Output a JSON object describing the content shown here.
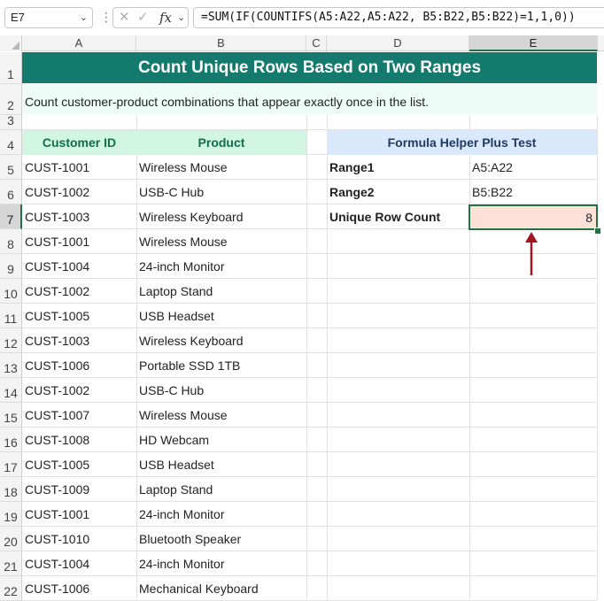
{
  "formula_bar": {
    "name_box": "E7",
    "formula": "=SUM(IF(COUNTIFS(A5:A22,A5:A22, B5:B22,B5:B22)=1,1,0))"
  },
  "columns": [
    "A",
    "B",
    "C",
    "D",
    "E"
  ],
  "selected_column": "E",
  "selected_row": "7",
  "rows": [
    "1",
    "2",
    "3",
    "4",
    "5",
    "6",
    "7",
    "8",
    "9",
    "10",
    "11",
    "12",
    "13",
    "14",
    "15",
    "16",
    "17",
    "18",
    "19",
    "20",
    "21",
    "22"
  ],
  "sheet": {
    "title": "Count Unique Rows Based on Two Ranges",
    "description": "Count customer-product combinations that appear exactly once in the list.",
    "table_headers": {
      "customer_id": "Customer ID",
      "product": "Product"
    },
    "table_rows": [
      {
        "id": "CUST-1001",
        "product": "Wireless Mouse"
      },
      {
        "id": "CUST-1002",
        "product": "USB-C Hub"
      },
      {
        "id": "CUST-1003",
        "product": "Wireless Keyboard"
      },
      {
        "id": "CUST-1001",
        "product": "Wireless Mouse"
      },
      {
        "id": "CUST-1004",
        "product": "24-inch Monitor"
      },
      {
        "id": "CUST-1002",
        "product": "Laptop Stand"
      },
      {
        "id": "CUST-1005",
        "product": "USB Headset"
      },
      {
        "id": "CUST-1003",
        "product": "Wireless Keyboard"
      },
      {
        "id": "CUST-1006",
        "product": "Portable SSD 1TB"
      },
      {
        "id": "CUST-1002",
        "product": "USB-C Hub"
      },
      {
        "id": "CUST-1007",
        "product": "Wireless Mouse"
      },
      {
        "id": "CUST-1008",
        "product": "HD Webcam"
      },
      {
        "id": "CUST-1005",
        "product": "USB Headset"
      },
      {
        "id": "CUST-1009",
        "product": "Laptop Stand"
      },
      {
        "id": "CUST-1001",
        "product": "24-inch Monitor"
      },
      {
        "id": "CUST-1010",
        "product": "Bluetooth Speaker"
      },
      {
        "id": "CUST-1004",
        "product": "24-inch Monitor"
      },
      {
        "id": "CUST-1006",
        "product": "Mechanical Keyboard"
      }
    ],
    "helper": {
      "header": "Formula Helper Plus Test",
      "range1_label": "Range1",
      "range1_value": "A5:A22",
      "range2_label": "Range2",
      "range2_value": "B5:B22",
      "result_label": "Unique Row Count",
      "result_value": "8"
    }
  },
  "colors": {
    "title_bg": "#147a6e",
    "desc_bg": "#eefcf8",
    "table_header_bg": "#d1f5e0",
    "helper_header_bg": "#d9e8fa",
    "result_bg": "#fde0d6",
    "arrow": "#a3161f",
    "selection": "#217346"
  }
}
